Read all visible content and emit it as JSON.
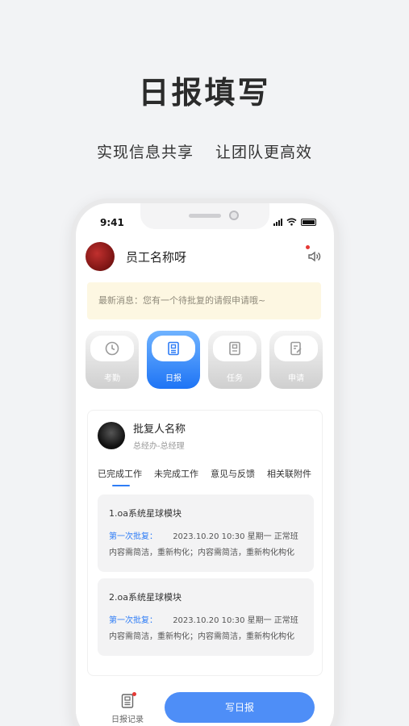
{
  "promo": {
    "title": "日报填写",
    "subtitle_left": "实现信息共享",
    "subtitle_right": "让团队更高效"
  },
  "status_bar": {
    "time": "9:41"
  },
  "user": {
    "name": "员工名称呀"
  },
  "notice": {
    "text": "最新消息：您有一个待批复的请假申请哦~"
  },
  "menu": {
    "items": [
      {
        "label": "考勤",
        "icon": "clock-icon",
        "active": false
      },
      {
        "label": "日报",
        "icon": "report-icon",
        "active": true
      },
      {
        "label": "任务",
        "icon": "task-icon",
        "active": false
      },
      {
        "label": "申请",
        "icon": "apply-icon",
        "active": false
      }
    ]
  },
  "approver": {
    "name": "批复人名称",
    "role": "总经办-总经理"
  },
  "tabs": [
    "已完成工作",
    "未完成工作",
    "意见与反馈",
    "相关联附件"
  ],
  "records": [
    {
      "title": "1.oa系统星球模块",
      "link": "第一次批复：",
      "meta": "2023.10.20  10:30  星期一  正常班",
      "content": "内容需简洁，重新构化；内容需简洁，重新构化构化"
    },
    {
      "title": "2.oa系统星球模块",
      "link": "第一次批复：",
      "meta": "2023.10.20  10:30  星期一  正常班",
      "content": "内容需简洁，重新构化；内容需简洁，重新构化构化"
    }
  ],
  "bottom": {
    "history_label": "日报记录",
    "write_button": "写日报"
  },
  "colors": {
    "accent": "#2f7df6",
    "button": "#4e8ef7",
    "notice_bg": "#fdf7e2",
    "badge": "#e53935"
  }
}
